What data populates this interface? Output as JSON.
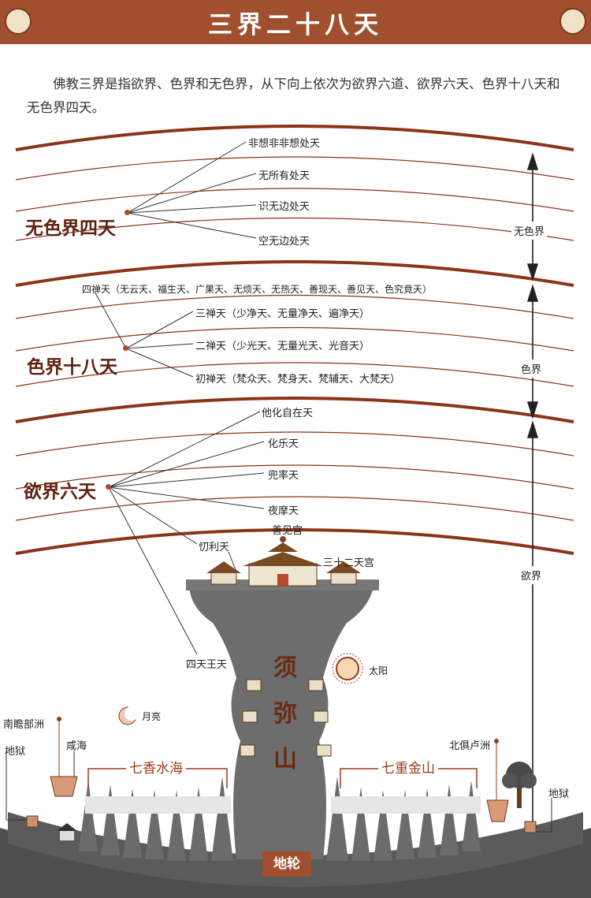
{
  "header": {
    "title": "三界二十八天"
  },
  "intro": "佛教三界是指欲界、色界和无色界，从下向上依次为欲界六道、欲界六天、色界十八天和无色界四天。",
  "realms": {
    "formless": {
      "name": "无色界四天",
      "side_label": "无色界",
      "heavens": [
        "非想非非想处天",
        "无所有处天",
        "识无边处天",
        "空无边处天"
      ]
    },
    "form": {
      "name": "色界十八天",
      "side_label": "色界",
      "heavens": [
        "四禅天（无云天、福生天、广果天、无烦天、无热天、善现天、善见天、色究竟天）",
        "三禅天（少净天、无量净天、遍净天）",
        "二禅天（少光天、无量光天、光音天）",
        "初禅天（梵众天、梵身天、梵辅天、大梵天）"
      ]
    },
    "desire": {
      "name": "欲界六天",
      "side_label": "欲界",
      "heavens": [
        "他化自在天",
        "化乐天",
        "兜率天",
        "夜摩天",
        "忉利天",
        "四天王天"
      ]
    }
  },
  "mountain": {
    "name_chars": [
      "须",
      "弥",
      "山"
    ],
    "summit_palace": "善见宫",
    "palaces_33": "三十二天宫",
    "sun": "太阳",
    "moon": "月亮",
    "left_sea": "七香水海",
    "right_mountains": "七重金山",
    "jambudvipa": "南瞻部洲",
    "salt_sea": "咸海",
    "hell_left": "地狱",
    "uttarakuru": "北俱卢洲",
    "hell_right": "地狱",
    "base": "地轮"
  },
  "colors": {
    "banner": "#a0502e",
    "heaven_line": "#8a3418",
    "realm_text": "#5e2210",
    "mountain": "#6d6d6d"
  }
}
